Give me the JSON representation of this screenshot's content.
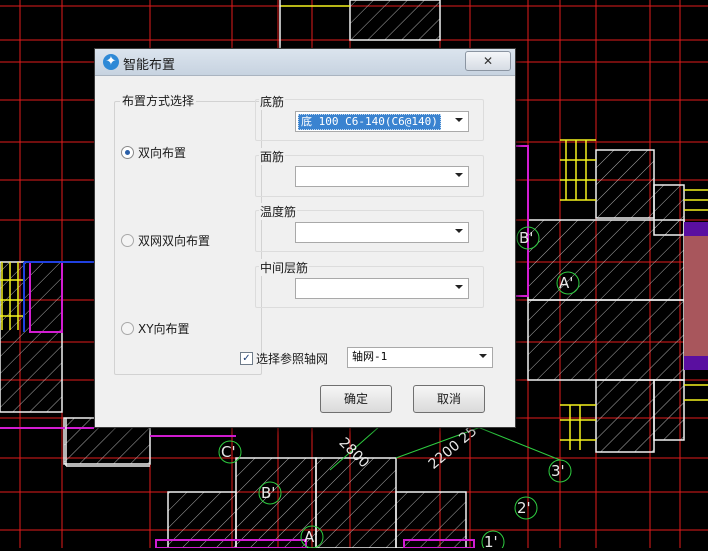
{
  "dialog": {
    "title": "智能布置",
    "close_label": "✕",
    "layout_group": {
      "title": "布置方式选择",
      "options": [
        {
          "label": "双向布置",
          "checked": true
        },
        {
          "label": "双网双向布置",
          "checked": false
        },
        {
          "label": "XY向布置",
          "checked": false
        }
      ]
    },
    "bottom_rebar": {
      "label": "底筋",
      "value": "底 100 C6-140(C6@140)"
    },
    "top_rebar": {
      "label": "面筋",
      "value": ""
    },
    "temperature_rebar": {
      "label": "温度筋",
      "value": ""
    },
    "middle_rebar": {
      "label": "中间层筋",
      "value": ""
    },
    "axis_checkbox": {
      "label": "选择参照轴网",
      "checked": true
    },
    "axis_select": {
      "value": "轴网-1"
    },
    "ok_label": "确定",
    "cancel_label": "取消"
  },
  "cad": {
    "labels": [
      "B'",
      "A'",
      "C'",
      "B'",
      "A'",
      "3'",
      "2'",
      "1'"
    ],
    "dimensions": [
      "2800",
      "2200 25"
    ]
  }
}
